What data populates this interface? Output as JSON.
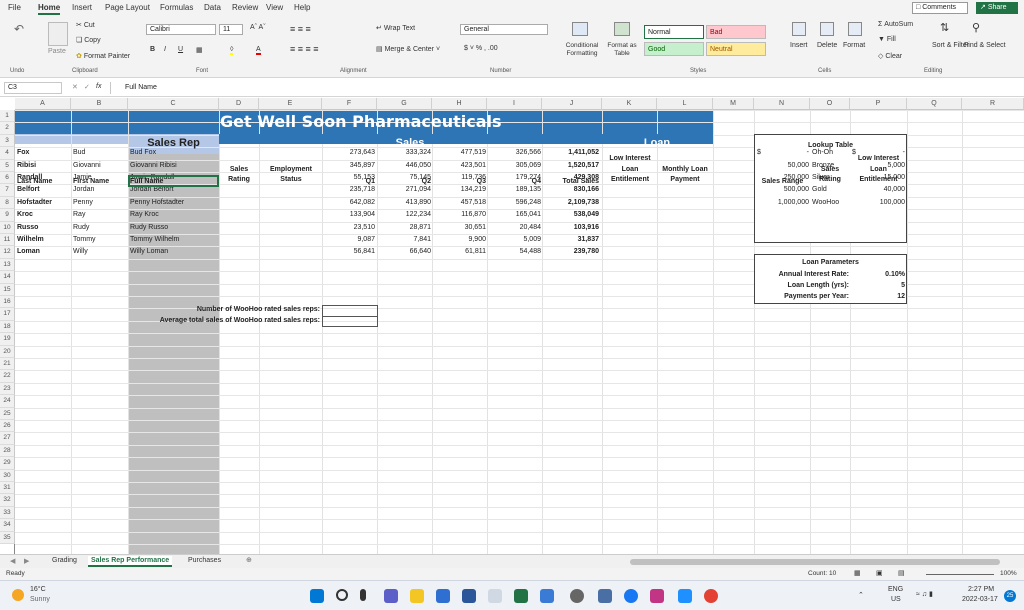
{
  "ribbon_tabs": [
    "File",
    "Home",
    "Insert",
    "Page Layout",
    "Formulas",
    "Data",
    "Review",
    "View",
    "Help"
  ],
  "header_buttons": {
    "comments": "Comments",
    "share": "Share"
  },
  "ribbon": {
    "undo": "Undo",
    "paste": "Paste",
    "cut": "Cut",
    "copy": "Copy",
    "format_painter": "Format Painter",
    "clipboard": "Clipboard",
    "font_name": "Calibri",
    "font_size": "11",
    "font_group": "Font",
    "wrap_text": "Wrap Text",
    "merge_center": "Merge & Center",
    "alignment": "Alignment",
    "number_format": "General",
    "number_group": "Number",
    "conditional_formatting": "Conditional Formatting",
    "format_as_table": "Format as Table",
    "styles": {
      "normal": "Normal",
      "bad": "Bad",
      "good": "Good",
      "neutral": "Neutral"
    },
    "styles_group": "Styles",
    "insert": "Insert",
    "delete": "Delete",
    "format": "Format",
    "cells_group": "Cells",
    "autosum": "AutoSum",
    "fill": "Fill",
    "clear": "Clear",
    "sort_filter": "Sort & Filter",
    "find_select": "Find & Select",
    "editing": "Editing"
  },
  "formula_bar": {
    "name_box": "C3",
    "fx": "fx",
    "content": "Full Name"
  },
  "columns": [
    "A",
    "B",
    "C",
    "D",
    "E",
    "F",
    "G",
    "H",
    "I",
    "J",
    "K",
    "L",
    "M",
    "N",
    "O",
    "P",
    "Q",
    "R"
  ],
  "row_numbers": [
    "1",
    "2",
    "3",
    "4",
    "5",
    "6",
    "7",
    "8",
    "9",
    "10",
    "11",
    "12",
    "13",
    "14",
    "15",
    "16",
    "17",
    "18",
    "19",
    "20",
    "21",
    "22",
    "23",
    "24",
    "25",
    "26",
    "27",
    "28",
    "29",
    "30",
    "31",
    "32",
    "33",
    "34",
    "35"
  ],
  "sheet": {
    "title": "Get Well Soon Pharmaceuticals",
    "sales_rep_header": "Sales Rep",
    "sales_header": "Sales",
    "loan_header": "Loan",
    "headers": {
      "last": "Last Name",
      "first": "First Name",
      "full": "Full Name",
      "rating1": "Sales",
      "rating2": "Rating",
      "emp1": "Employment",
      "emp2": "Status",
      "q1": "Q1",
      "q2": "Q2",
      "q3": "Q3",
      "q4": "Q4",
      "total": "Total Sales",
      "lil1": "Low Interest",
      "lil2": "Loan",
      "lil3": "Entitlement",
      "mlp1": "Monthly Loan",
      "mlp2": "Payment"
    },
    "rows": [
      [
        "Fox",
        "Bud",
        "Bud Fox",
        "273,643",
        "333,324",
        "477,519",
        "326,566",
        "1,411,052"
      ],
      [
        "Ribisi",
        "Giovanni",
        "Giovanni Ribisi",
        "345,897",
        "446,050",
        "423,501",
        "305,069",
        "1,520,517"
      ],
      [
        "Randall",
        "Jamie",
        "Jamie Randall",
        "55,153",
        "75,145",
        "119,736",
        "179,274",
        "429,308"
      ],
      [
        "Belfort",
        "Jordan",
        "Jordan Belfort",
        "235,718",
        "271,094",
        "134,219",
        "189,135",
        "830,166"
      ],
      [
        "Hofstadter",
        "Penny",
        "Penny Hofstadter",
        "642,082",
        "413,890",
        "457,518",
        "596,248",
        "2,109,738"
      ],
      [
        "Kroc",
        "Ray",
        "Ray Kroc",
        "133,904",
        "122,234",
        "116,870",
        "165,041",
        "538,049"
      ],
      [
        "Russo",
        "Rudy",
        "Rudy Russo",
        "23,510",
        "28,871",
        "30,651",
        "20,484",
        "103,916"
      ],
      [
        "Wilhelm",
        "Tommy",
        "Tommy Wilhelm",
        "9,087",
        "7,841",
        "9,900",
        "5,009",
        "31,837"
      ],
      [
        "Loman",
        "Willy",
        "Willy Loman",
        "56,841",
        "66,640",
        "61,811",
        "54,488",
        "239,780"
      ]
    ],
    "woohoo_count_label": "Number of WooHoo rated sales reps:",
    "woohoo_avg_label": "Average total sales of WooHoo rated sales reps:",
    "lookup": {
      "title": "Lookup Table",
      "h_range": "Sales Range",
      "h_rating1": "Sales",
      "h_rating2": "Rating",
      "h_ent1": "Low Interest",
      "h_ent2": "Loan",
      "h_ent3": "Entitlement",
      "rows": [
        [
          "$",
          "-",
          "Oh-Oh",
          "$",
          "-"
        ],
        [
          "",
          "50,000",
          "Bronze",
          "",
          "5,000"
        ],
        [
          "",
          "250,000",
          "Silver",
          "",
          "15,000"
        ],
        [
          "",
          "500,000",
          "Gold",
          "",
          "40,000"
        ],
        [
          "",
          "1,000,000",
          "WooHoo",
          "",
          "100,000"
        ]
      ]
    },
    "loan_params": {
      "title": "Loan Parameters",
      "rate_label": "Annual Interest Rate:",
      "rate": "0.10%",
      "length_label": "Loan Length (yrs):",
      "length": "5",
      "ppy_label": "Payments per Year:",
      "ppy": "12"
    }
  },
  "sheet_tabs": [
    "Grading",
    "Sales Rep Performance",
    "Purchases"
  ],
  "status": {
    "ready": "Ready",
    "count": "Count: 10",
    "zoom": "100%"
  },
  "taskbar": {
    "temp": "16°C",
    "weather": "Sunny",
    "lang1": "ENG",
    "lang2": "US",
    "time": "2:27 PM",
    "date": "2022-03-17",
    "badge": "25"
  }
}
